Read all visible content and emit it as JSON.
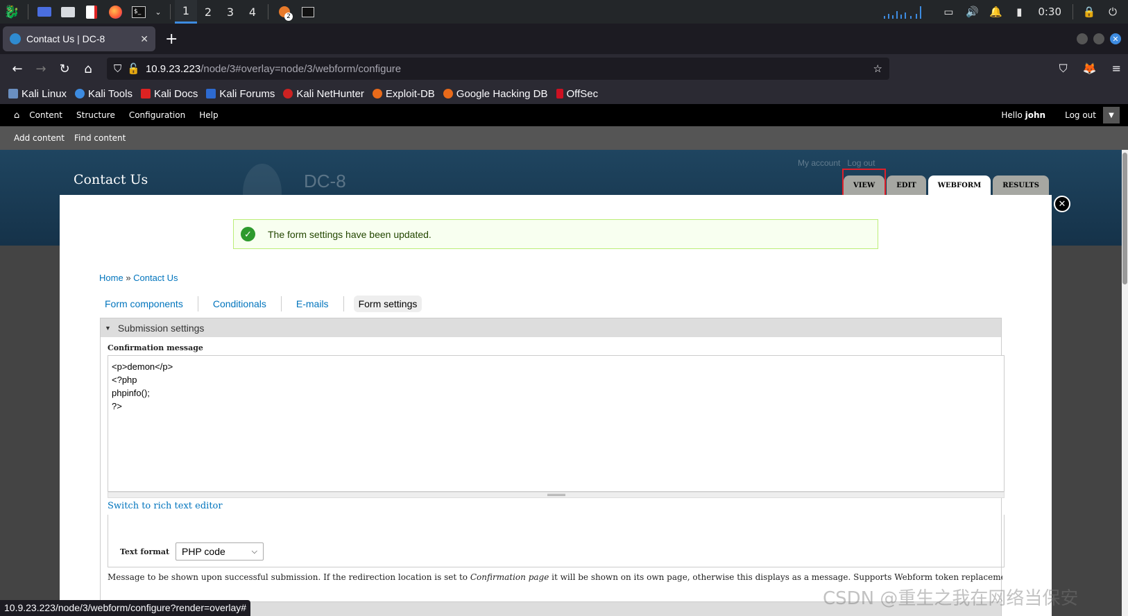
{
  "taskbar": {
    "workspaces": [
      "1",
      "2",
      "3",
      "4"
    ],
    "active_workspace": "1",
    "badge": "2",
    "clock": "0:30",
    "icons": [
      "kali-menu-icon",
      "desktop-icon",
      "file-manager-icon",
      "text-editor-icon",
      "firefox-icon",
      "terminal-icon"
    ]
  },
  "browser": {
    "tab_title": "Contact Us | DC-8",
    "url_host": "10.9.23.223",
    "url_path": "/node/3#overlay=node/3/webform/configure",
    "bookmarks": [
      "Kali Linux",
      "Kali Tools",
      "Kali Docs",
      "Kali Forums",
      "Kali NetHunter",
      "Exploit-DB",
      "Google Hacking DB",
      "OffSec"
    ],
    "status_url": "10.9.23.223/node/3/webform/configure?render=overlay#"
  },
  "toolbar": {
    "menu": [
      "Content",
      "Structure",
      "Configuration",
      "Help"
    ],
    "hello": "Hello",
    "user": "john",
    "logout": "Log out",
    "shortcuts": [
      "Add content",
      "Find content"
    ]
  },
  "site": {
    "name": "DC-8",
    "my_account": "My account",
    "log_out": "Log out"
  },
  "overlay": {
    "title": "Contact Us",
    "tabs": [
      "VIEW",
      "EDIT",
      "WEBFORM",
      "RESULTS"
    ],
    "active_tab": "WEBFORM",
    "message": "The form settings have been updated.",
    "breadcrumb": {
      "home": "Home",
      "sep": "»",
      "current": "Contact Us"
    },
    "form_tabs": [
      "Form components",
      "Conditionals",
      "E-mails",
      "Form settings"
    ],
    "active_form_tab": "Form settings",
    "fieldset": "Submission settings",
    "confirmation_label": "Confirmation message",
    "confirmation_value": "<p>demon</p>\n<?php\nphpinfo();\n?>",
    "rich_text_link": "Switch to rich text editor",
    "text_format_label": "Text format",
    "text_format_value": "PHP code",
    "description": {
      "before": "Message to be shown upon successful submission. If the redirection location is set to ",
      "italic": "Confirmation page",
      "after": " it will be shown on its own page, otherwise this displays as a message. Supports Webform token replacements."
    }
  },
  "watermark": "CSDN @重生之我在网络当保安"
}
